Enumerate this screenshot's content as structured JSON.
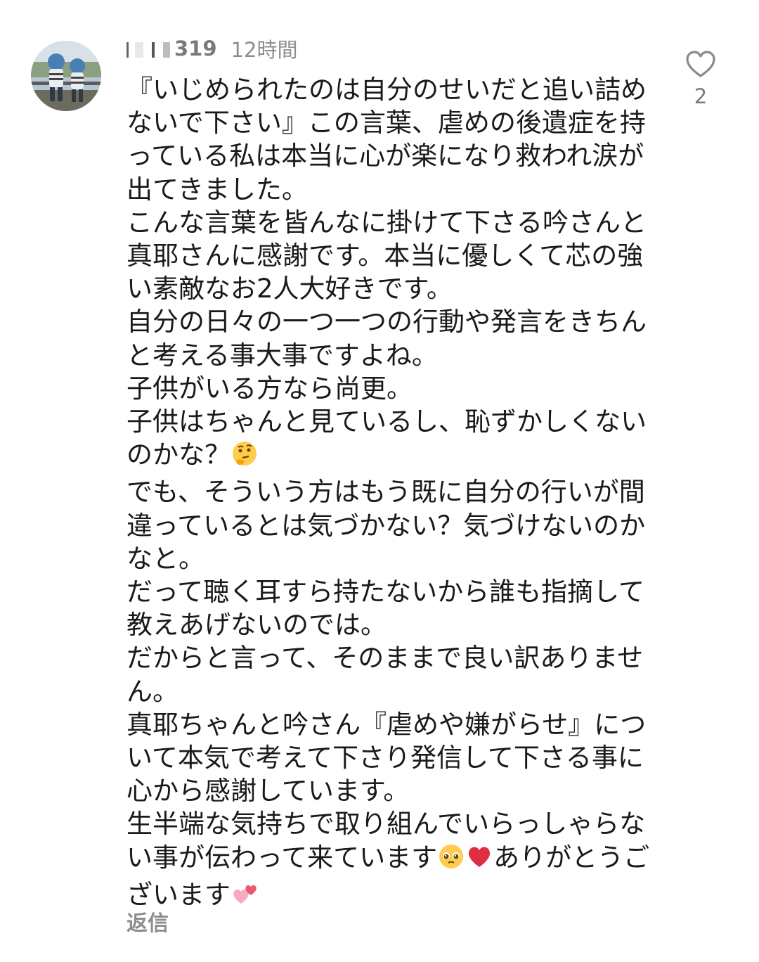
{
  "comment": {
    "username_visible": "319",
    "time": "12時間",
    "paragraphs": [
      "『いじめられたのは自分のせいだと追い詰めないで下さい』この言葉、虐めの後遺症を持っている私は本当に心が楽になり救われ涙が出てきました。",
      "こんな言葉を皆んなに掛けて下さる吟さんと真耶さんに感謝です。本当に優しくて芯の強い素敵なお2人大好きです。",
      "自分の日々の一つ一つの行動や発言をきちんと考える事大事ですよね。",
      "子供がいる方なら尚更。",
      "子供はちゃんと見ているし、恥ずかしくないのかな？",
      "でも、そういう方はもう既に自分の行いが間違っているとは気づかない？気づけないのかなと。",
      "だって聴く耳すら持たないから誰も指摘して教えあげないのでは。",
      "だからと言って、そのままで良い訳ありません。",
      "真耶ちゃんと吟さん『虐めや嫌がらせ』について本気で考えて下さり発信して下さる事に心から感謝しています。",
      "生半端な気持ちで取り組んでいらっしゃらない事が伝わって来ています",
      "ありがとうございます"
    ],
    "reply_label": "返信",
    "like_count": "2"
  },
  "emojis": {
    "thinking": "thinking-face-icon",
    "pleading": "pleading-face-icon",
    "heart": "red-heart-icon",
    "two_hearts": "two-hearts-icon"
  },
  "colors": {
    "text": "#1a1a1a",
    "muted": "#8e8e8e",
    "icon": "#7a7a7a"
  }
}
